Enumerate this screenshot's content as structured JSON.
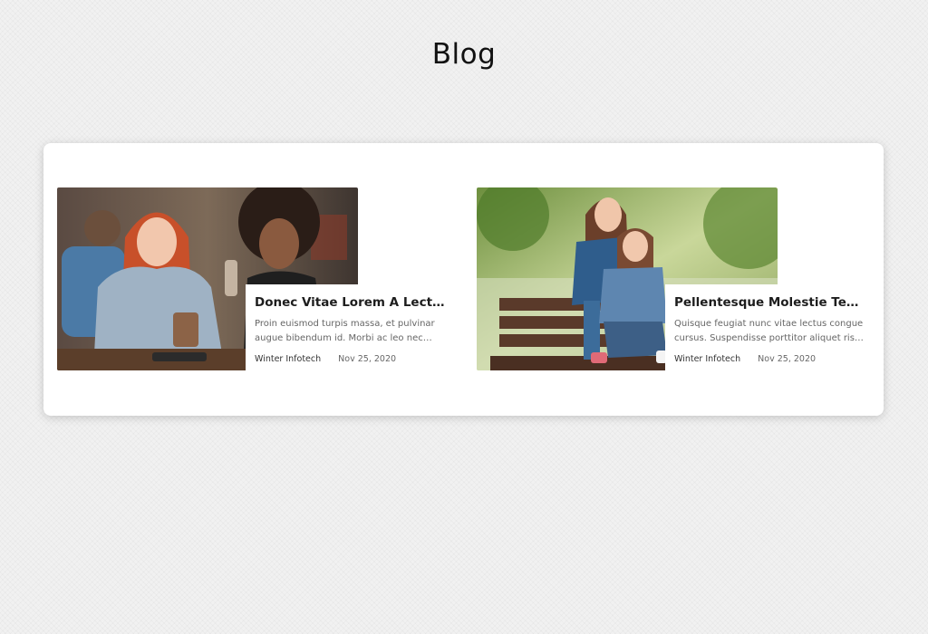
{
  "page": {
    "title": "Blog"
  },
  "posts": [
    {
      "title": "Donec Vitae Lorem A Lectus Viverra",
      "excerpt": "Proin euismod turpis massa, et pulvinar augue bibendum id. Morbi ac leo nec semper ipsum dolor.",
      "author": "Winter Infotech",
      "date": "Nov 25, 2020",
      "image_alt": "two-women-cafe-photo"
    },
    {
      "title": "Pellentesque Molestie Tempor Nisi",
      "excerpt": "Quisque feugiat nunc vitae lectus congue cursus. Suspendisse porttitor aliquet risus vitae.",
      "author": "Winter Infotech",
      "date": "Nov 25, 2020",
      "image_alt": "two-women-park-bench-photo"
    }
  ]
}
